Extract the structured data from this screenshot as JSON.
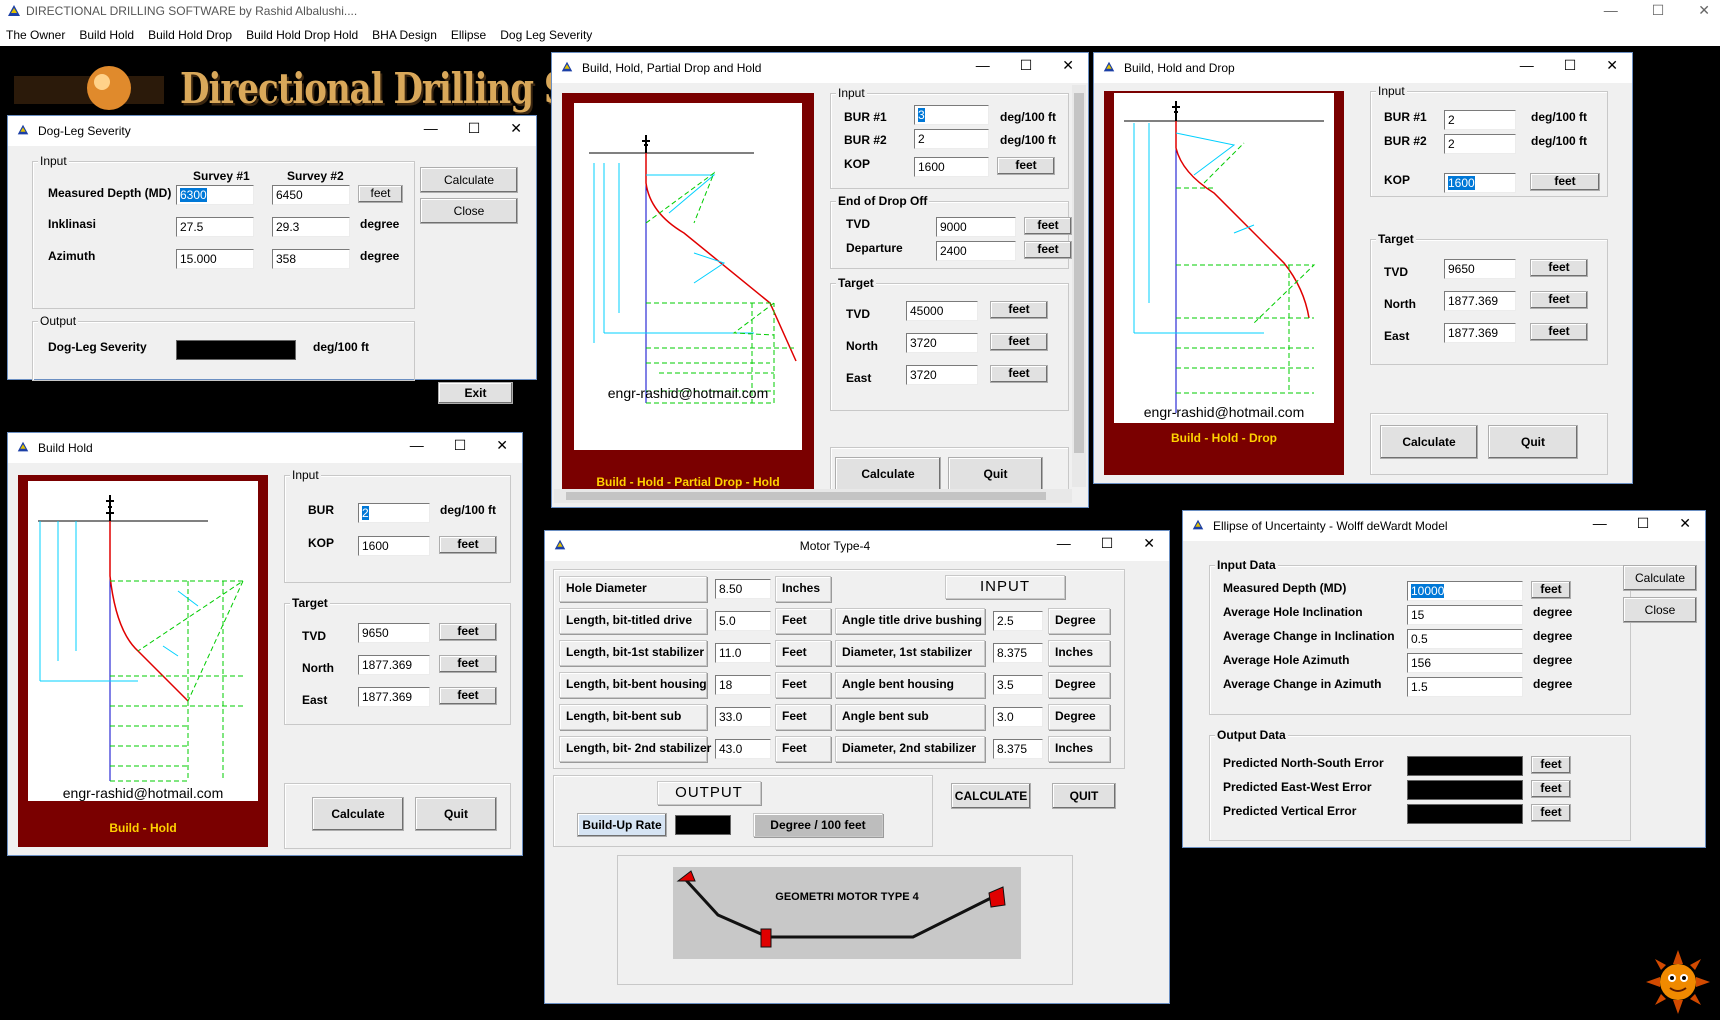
{
  "app": {
    "title": "DIRECTIONAL DRILLING SOFTWARE by Rashid Albalushi....",
    "menu": [
      "The Owner",
      "Build Hold",
      "Build Hold Drop",
      "Build Hold Drop Hold",
      "BHA Design",
      "Ellipse",
      "Dog Leg Severity"
    ],
    "banner": "Directional Drilling Software",
    "controls": {
      "minimize": "—",
      "maximize": "☐",
      "close": "✕"
    }
  },
  "dogleg": {
    "title": "Dog-Leg Severity",
    "input_label": "Input",
    "survey1": "Survey #1",
    "survey2": "Survey #2",
    "md_label": "Measured Depth (MD)",
    "md1": "6300",
    "md2": "6450",
    "md_unit": "feet",
    "inc_label": "Inklinasi",
    "inc1": "27.5",
    "inc2": "29.3",
    "inc_unit": "degree",
    "az_label": "Azimuth",
    "az1": "15.000",
    "az2": "358",
    "az_unit": "degree",
    "calculate": "Calculate",
    "close": "Close",
    "output_label": "Output",
    "dls_label": "Dog-Leg Severity",
    "dls_unit": "deg/100 ft",
    "exit": "Exit"
  },
  "bhpdh": {
    "title": "Build, Hold, Partial Drop and Hold",
    "email": "engr-rashid@hotmail.com",
    "caption": "Build - Hold - Partial Drop - Hold",
    "input_label": "Input",
    "bur1_label": "BUR #1",
    "bur1": "3",
    "bur_unit": "deg/100 ft",
    "bur2_label": "BUR #2",
    "bur2": "2",
    "kop_label": "KOP",
    "kop": "1600",
    "feet": "feet",
    "eod_label": "End of Drop Off",
    "tvd_label": "TVD",
    "eod_tvd": "9000",
    "dep_label": "Departure",
    "eod_dep": "2400",
    "target_label": "Target",
    "t_tvd": "45000",
    "north_label": "North",
    "t_north": "3720",
    "east_label": "East",
    "t_east": "3720",
    "calculate": "Calculate",
    "quit": "Quit"
  },
  "bhd": {
    "title": "Build, Hold and Drop",
    "email": "engr-rashid@hotmail.com",
    "caption": "Build - Hold - Drop",
    "input_label": "Input",
    "bur1_label": "BUR #1",
    "bur1": "2",
    "bur_unit": "deg/100 ft",
    "bur2_label": "BUR #2",
    "bur2": "2",
    "kop_label": "KOP",
    "kop": "1600",
    "feet": "feet",
    "target_label": "Target",
    "tvd_label": "TVD",
    "tvd": "9650",
    "north_label": "North",
    "north": "1877.369",
    "east_label": "East",
    "east": "1877.369",
    "calculate": "Calculate",
    "quit": "Quit"
  },
  "bh": {
    "title": "Build  Hold",
    "email": "engr-rashid@hotmail.com",
    "caption": "Build - Hold",
    "input_label": "Input",
    "bur_label": "BUR",
    "bur": "2",
    "bur_unit": "deg/100 ft",
    "kop_label": "KOP",
    "kop": "1600",
    "feet": "feet",
    "target_label": "Target",
    "tvd_label": "TVD",
    "tvd": "9650",
    "north_label": "North",
    "north": "1877.369",
    "east_label": "East",
    "east": "1877.369",
    "calculate": "Calculate",
    "quit": "Quit"
  },
  "motor": {
    "title": "Motor Type-4",
    "rows_left": [
      {
        "label": "Hole Diameter",
        "value": "8.50",
        "unit": "Inches"
      },
      {
        "label": "Length, bit-titled drive",
        "value": "5.0",
        "unit": "Feet"
      },
      {
        "label": "Length, bit-1st stabilizer",
        "value": "11.0",
        "unit": "Feet"
      },
      {
        "label": "Length, bit-bent housing",
        "value": "18",
        "unit": "Feet"
      },
      {
        "label": "Length, bit-bent sub",
        "value": "33.0",
        "unit": "Feet"
      },
      {
        "label": "Length, bit- 2nd stabilizer",
        "value": "43.0",
        "unit": "Feet"
      }
    ],
    "input_header": "INPUT",
    "rows_right": [
      {
        "label": "Angle title drive bushing",
        "value": "2.5",
        "unit": "Degree"
      },
      {
        "label": "Diameter, 1st stabilizer",
        "value": "8.375",
        "unit": "Inches"
      },
      {
        "label": "Angle bent housing",
        "value": "3.5",
        "unit": "Degree"
      },
      {
        "label": "Angle bent sub",
        "value": "3.0",
        "unit": "Degree"
      },
      {
        "label": "Diameter, 2nd stabilizer",
        "value": "8.375",
        "unit": "Inches"
      }
    ],
    "output_header": "OUTPUT",
    "bur_label": "Build-Up Rate",
    "bur_unit": "Degree / 100 feet",
    "calculate": "CALCULATE",
    "quit": "QUIT",
    "geometry_label": "GEOMETRI MOTOR TYPE 4"
  },
  "ellipse": {
    "title": "Ellipse of Uncertainty - Wolff deWardt Model",
    "input_label": "Input Data",
    "md_label": "Measured Depth (MD)",
    "md": "10000",
    "md_unit": "feet",
    "ahi_label": "Average Hole Inclination",
    "ahi": "15",
    "deg": "degree",
    "aci_label": "Average Change in Inclination",
    "aci": "0.5",
    "aha_label": "Average Hole Azimuth",
    "aha": "156",
    "aca_label": "Average Change in Azimuth",
    "aca": "1.5",
    "calculate": "Calculate",
    "close": "Close",
    "output_label": "Output Data",
    "ns_label": "Predicted North-South Error",
    "ew_label": "Predicted East-West Error",
    "v_label": "Predicted Vertical Error",
    "feet": "feet"
  }
}
